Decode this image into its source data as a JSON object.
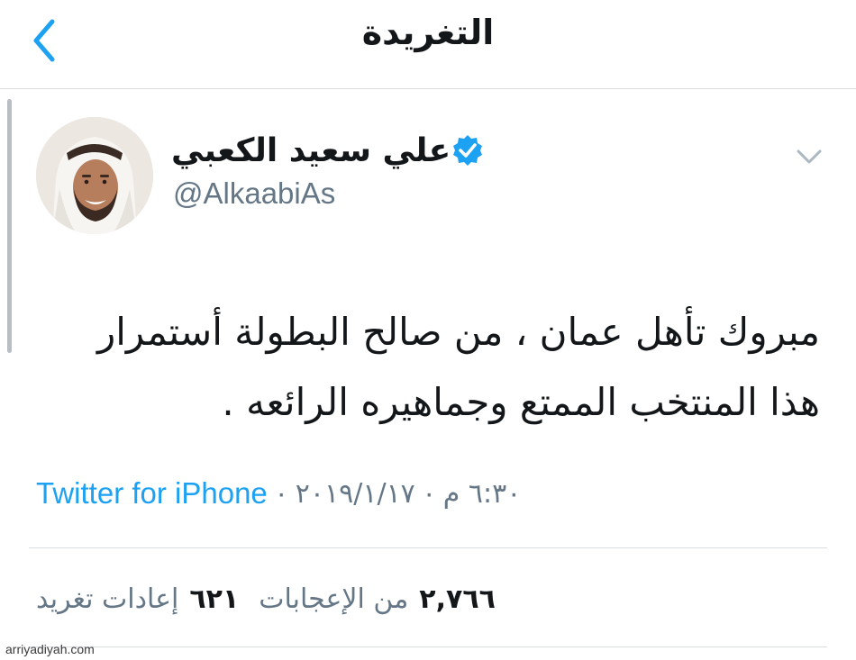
{
  "header": {
    "title": "التغريدة",
    "back_icon": "chevron-left-icon"
  },
  "author": {
    "name": "علي سعيد الكعبي",
    "handle": "@AlkaabiAs",
    "verified": true,
    "verified_color": "#1da1f2"
  },
  "tweet": {
    "text": "مبروك تأهل عمان ، من صالح البطولة أستمرار هذا المنتخب الممتع وجماهيره الرائعه ."
  },
  "meta": {
    "time": "٦:٣٠ م",
    "separator": "·",
    "date": "٢٠١٩/١/١٧",
    "source": "Twitter for iPhone"
  },
  "counts": {
    "likes_number": "٢,٧٦٦",
    "likes_label": "من الإعجابات",
    "retweets_number": "٦٢١",
    "retweets_label": "إعادات تغريد"
  },
  "colors": {
    "accent": "#1da1f2",
    "text_primary": "#14171a",
    "text_secondary": "#657786",
    "divider": "#d9dde1"
  },
  "watermark": "arriyadiyah.com"
}
